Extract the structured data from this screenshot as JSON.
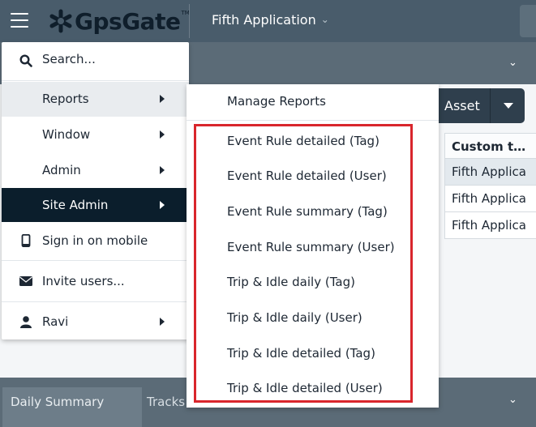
{
  "header": {
    "logo_text": "GpsGate",
    "logo_tm": "TM",
    "app_name": "Fifth Application"
  },
  "toolbar": {
    "asset_label": "Asset"
  },
  "grid": {
    "column_header": "Custom t…",
    "rows": [
      "Fifth Applica",
      "Fifth Applica",
      "Fifth Applica"
    ]
  },
  "bottom_tabs": [
    "Daily Summary",
    "Tracks"
  ],
  "menu": {
    "items": [
      {
        "label": "Search...",
        "icon": "search-icon"
      },
      {
        "label": "Reports",
        "has_submenu": true
      },
      {
        "label": "Window",
        "has_submenu": true
      },
      {
        "label": "Admin",
        "has_submenu": true
      },
      {
        "label": "Site Admin",
        "has_submenu": true
      },
      {
        "label": "Sign in on mobile",
        "icon": "mobile-phone-icon"
      },
      {
        "label": "Invite users...",
        "icon": "envelope-icon"
      },
      {
        "label": "Ravi",
        "icon": "user-icon",
        "has_submenu": true
      }
    ]
  },
  "submenu": {
    "items": [
      "Manage Reports",
      "Event Rule detailed (Tag)",
      "Event Rule detailed (User)",
      "Event Rule summary (Tag)",
      "Event Rule summary (User)",
      "Trip & Idle daily (Tag)",
      "Trip & Idle daily (User)",
      "Trip & Idle detailed (Tag)",
      "Trip & Idle detailed (User)"
    ]
  },
  "colors": {
    "topbar": "#495c6b",
    "active_menu": "#0b1e2c",
    "highlight": "#d9262c"
  }
}
